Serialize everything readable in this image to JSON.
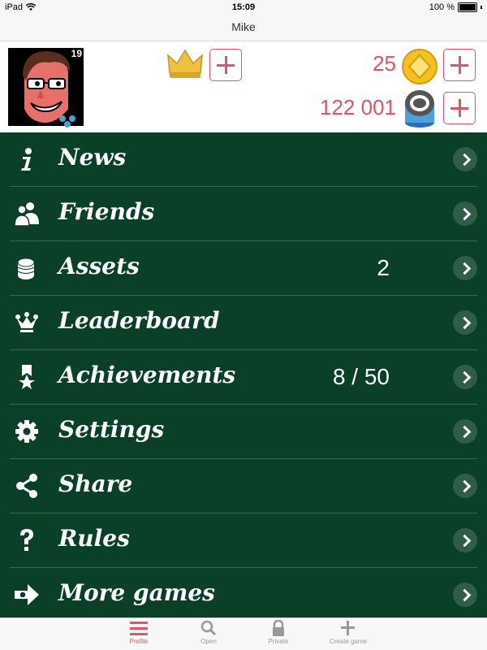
{
  "status": {
    "device": "iPad",
    "time": "15:09",
    "battery": "100 %"
  },
  "nav": {
    "title": "Mike"
  },
  "profile": {
    "level": "19",
    "coins": "25",
    "chips": "122 001"
  },
  "menu": {
    "items": [
      {
        "label": "News",
        "value": "",
        "icon": "info-icon"
      },
      {
        "label": "Friends",
        "value": "",
        "icon": "friends-icon"
      },
      {
        "label": "Assets",
        "value": "2",
        "icon": "coins-stack-icon"
      },
      {
        "label": "Leaderboard",
        "value": "",
        "icon": "crown-icon"
      },
      {
        "label": "Achievements",
        "value": "8 / 50",
        "icon": "ribbon-star-icon"
      },
      {
        "label": "Settings",
        "value": "",
        "icon": "gear-icon"
      },
      {
        "label": "Share",
        "value": "",
        "icon": "share-icon"
      },
      {
        "label": "Rules",
        "value": "",
        "icon": "question-icon"
      },
      {
        "label": "More games",
        "value": "",
        "icon": "arrow-plus-icon"
      }
    ]
  },
  "tabs": [
    {
      "label": "Profile",
      "icon": "menu-icon"
    },
    {
      "label": "Open",
      "icon": "search-icon"
    },
    {
      "label": "Private",
      "icon": "lock-icon"
    },
    {
      "label": "Create game",
      "icon": "plus-icon"
    }
  ],
  "colors": {
    "accent": "#e0556a",
    "menu_bg": "#0a3f28",
    "divider": "#356a52"
  }
}
